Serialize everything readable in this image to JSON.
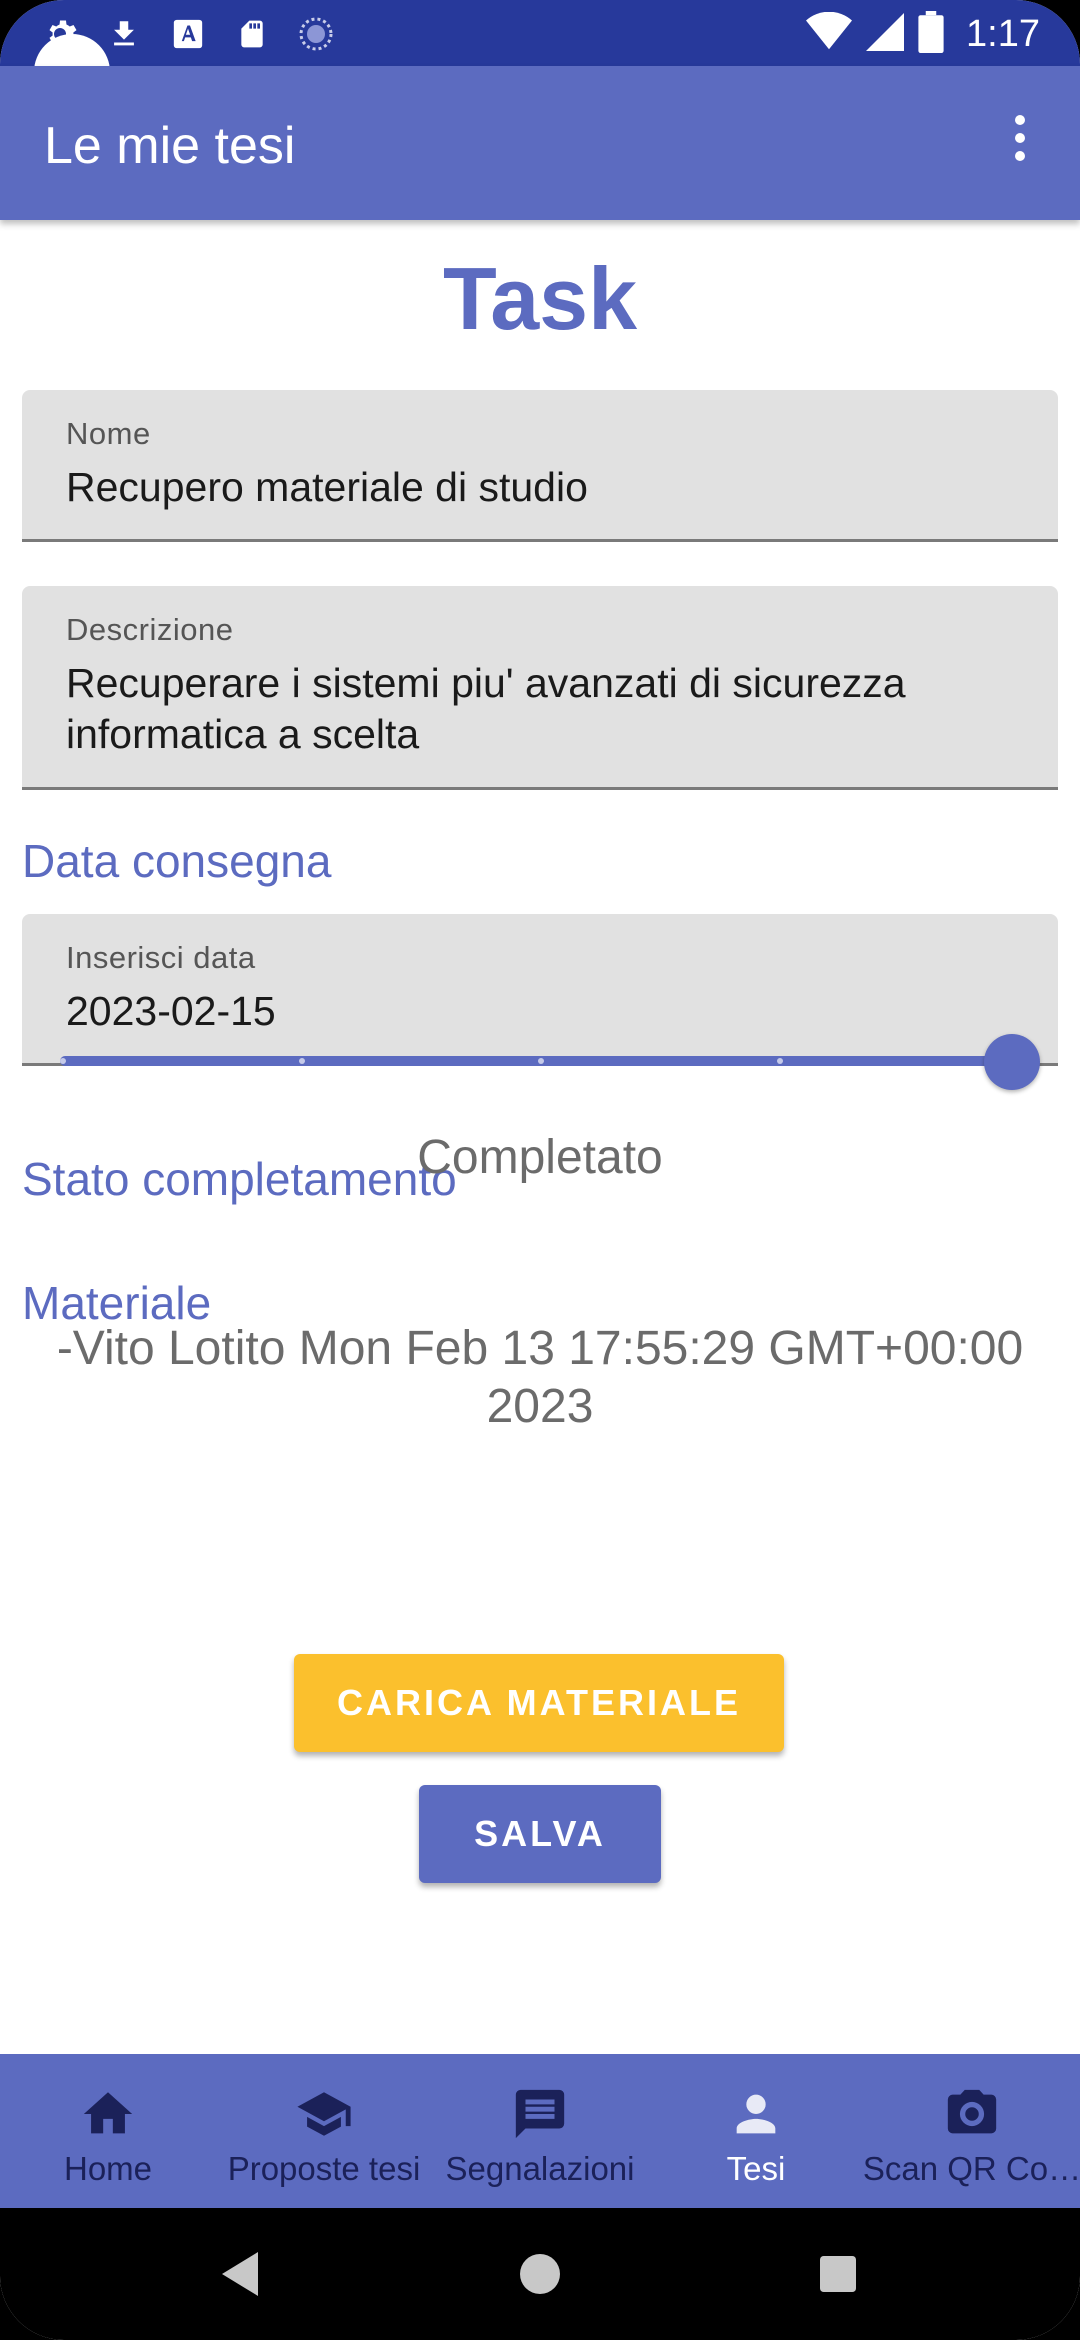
{
  "status_bar": {
    "time": "1:17",
    "left_icons": [
      "settings-icon",
      "download-icon",
      "font-icon",
      "sd-card-icon",
      "loading-icon"
    ],
    "right_icons": [
      "wifi-icon",
      "signal-icon",
      "battery-icon"
    ]
  },
  "app_bar": {
    "title": "Le mie tesi",
    "overflow_icon": "more-vert-icon"
  },
  "page": {
    "title": "Task"
  },
  "form": {
    "name": {
      "label": "Nome",
      "value": "Recupero materiale di studio"
    },
    "description": {
      "label": "Descrizione",
      "value": "Recuperare i sistemi piu' avanzati di sicurezza informatica a scelta"
    },
    "due_section_label": "Data consegna",
    "due_date": {
      "label": "Inserisci data",
      "value": "2023-02-15"
    },
    "completion_section_label": "Stato completamento",
    "completion": {
      "steps": 5,
      "selected_step": 5,
      "fraction": 1.0
    },
    "completion_text": "Completato",
    "material_section_label": "Materiale",
    "material_entry": "-Vito Lotito Mon Feb 13 17:55:29 GMT+00:00 2023",
    "upload_button": "CARICA MATERIALE",
    "save_button": "SALVA"
  },
  "colors": {
    "primary": "#5c6bc0",
    "status_bar": "#27399b",
    "accent": "#fbc02d"
  },
  "bottom_nav": {
    "items": [
      {
        "label": "Home",
        "icon": "home-icon",
        "active": false
      },
      {
        "label": "Proposte tesi",
        "icon": "school-icon",
        "active": false
      },
      {
        "label": "Segnalazioni",
        "icon": "message-icon",
        "active": false
      },
      {
        "label": "Tesi",
        "icon": "person-icon",
        "active": true
      },
      {
        "label": "Scan QR Co…",
        "icon": "camera-icon",
        "active": false
      }
    ]
  },
  "system_nav": {
    "icons": [
      "back-icon",
      "home-circle-icon",
      "recents-icon"
    ]
  }
}
